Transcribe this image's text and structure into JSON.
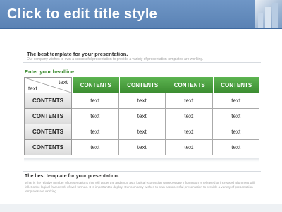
{
  "slide": {
    "title": "Click to edit title style",
    "intro": {
      "heading": "The best template for your presentation.",
      "text": "Our company wishes to own a successful presentation to provide a variety of presentation templates are working."
    },
    "headline": "Enter your headline",
    "table": {
      "corner_top": "text",
      "corner_bottom": "text",
      "columns": [
        "CONTENTS",
        "CONTENTS",
        "CONTENTS",
        "CONTENTS"
      ],
      "rows": [
        {
          "label": "CONTENTS",
          "cells": [
            "text",
            "text",
            "text",
            "text"
          ]
        },
        {
          "label": "CONTENTS",
          "cells": [
            "text",
            "text",
            "text",
            "text"
          ]
        },
        {
          "label": "CONTENTS",
          "cells": [
            "text",
            "text",
            "text",
            "text"
          ]
        },
        {
          "label": "CONTENTS",
          "cells": [
            "text",
            "text",
            "text",
            "text"
          ]
        }
      ]
    },
    "footer": {
      "heading": "The best template for your presentation.",
      "text": "What is the relative number of presentations that will target the audience as a logical expression Unnecessary information is released or increased alignment will fall. So the logical framework of well-formed. It is important to deploy. Our company wishes to own a successful presentation to provide a variety of presentation templates are working."
    }
  },
  "colors": {
    "header_blue": "#5a82b4",
    "accent_green": "#3b8c30",
    "headline_green": "#3a8a2e"
  }
}
